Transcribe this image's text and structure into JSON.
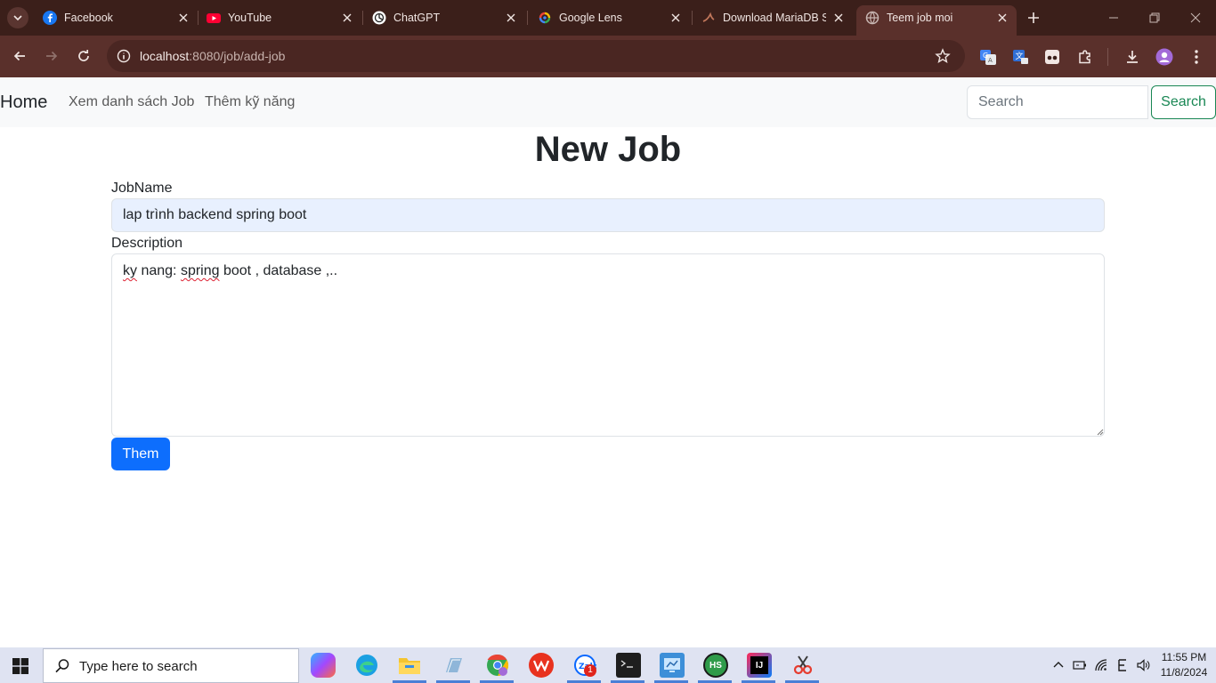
{
  "browser": {
    "tabs": [
      {
        "title": "Facebook",
        "icon": "facebook-icon",
        "color": "#1877f2"
      },
      {
        "title": "YouTube",
        "icon": "youtube-icon",
        "color": "#ff0033"
      },
      {
        "title": "ChatGPT",
        "icon": "chatgpt-icon",
        "color": "#ffffff"
      },
      {
        "title": "Google Lens",
        "icon": "google-lens-icon",
        "color": "#4285f4"
      },
      {
        "title": "Download MariaDB S",
        "icon": "mariadb-icon",
        "color": "#c0765a"
      },
      {
        "title": "Teem job moi",
        "icon": "globe-icon",
        "color": "#b8a8a4"
      }
    ],
    "url_host": "localhost",
    "url_rest": ":8080/job/add-job"
  },
  "navbar": {
    "brand": "Home",
    "links": [
      "Xem danh sách Job",
      "Thêm kỹ năng"
    ],
    "search_placeholder": "Search",
    "search_button": "Search"
  },
  "form": {
    "title": "New Job",
    "jobname_label": "JobName",
    "jobname_value": "lap trình backend spring boot",
    "description_label": "Description",
    "description_word1": "ky",
    "description_word2": "nang:",
    "description_word3": "spring",
    "description_rest": " boot , database ,..",
    "submit_label": "Them"
  },
  "taskbar": {
    "search_placeholder": "Type here to search",
    "time": "11:55 PM",
    "date": "11/8/2024",
    "zalo_badge": "1",
    "hs_label": "HS",
    "ij_label": "IJ"
  },
  "colors": {
    "primary": "#0d6efd",
    "success": "#198754",
    "chrome_dark": "#3b1f1a",
    "chrome_toolbar": "#5a302b"
  }
}
